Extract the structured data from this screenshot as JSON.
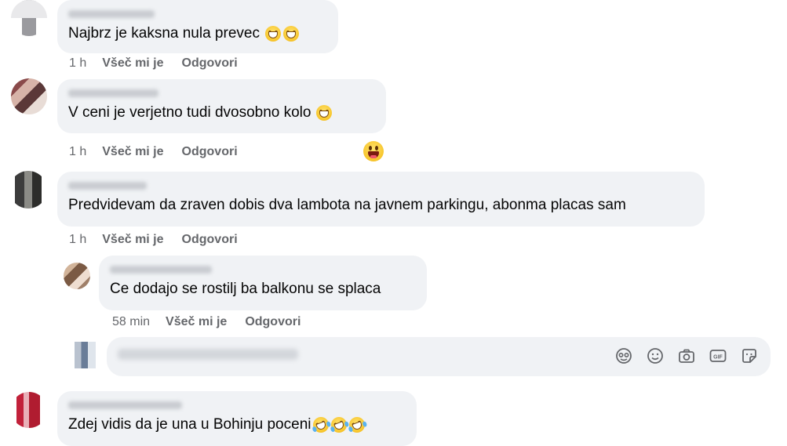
{
  "comments": [
    {
      "text": "Najbrz je kaksna nula prevec",
      "time": "1 h",
      "like": "Všeč mi je",
      "reply": "Odgovori"
    },
    {
      "text": "V ceni je verjetno tudi dvosobno kolo",
      "time": "1 h",
      "like": "Všeč mi je",
      "reply": "Odgovori"
    },
    {
      "text": "Predvidevam da zraven dobis dva lambota na javnem parkingu, abonma placas sam",
      "time": "1 h",
      "like": "Všeč mi je",
      "reply": "Odgovori"
    },
    {
      "text": "Ce dodajo se rostilj ba balkonu se splaca",
      "time": "58 min",
      "like": "Všeč mi je",
      "reply": "Odgovori"
    },
    {
      "text": "Zdej vidis da je una u Bohinju poceni"
    }
  ],
  "reply_input": {
    "placeholder": "",
    "icons": [
      "avatar-sticker-icon",
      "emoji-icon",
      "camera-icon",
      "gif-icon",
      "sticker-icon"
    ]
  },
  "icons": {
    "grinning": "grinning-emoji-icon",
    "laughing": "rolling-laughing-emoji-icon",
    "reaction": "haha-reaction-icon"
  },
  "colors": {
    "bubble": "#f0f2f5",
    "meta": "#65676b",
    "text": "#050505"
  }
}
